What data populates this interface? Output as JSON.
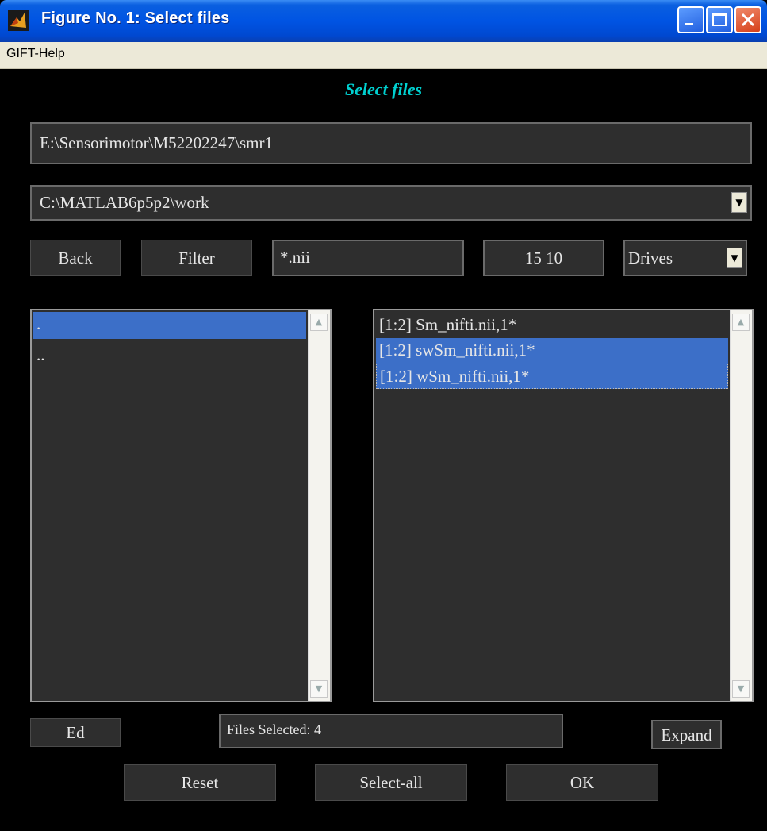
{
  "window": {
    "title": "Figure No. 1: Select files",
    "app_icon": "matlab-icon",
    "controls": [
      "minimize-icon",
      "maximize-icon",
      "close-icon"
    ]
  },
  "menubar": {
    "items": [
      "GIFT-Help"
    ]
  },
  "heading": "Select files",
  "current_dir": "E:\\Sensorimotor\\M52202247\\smr1",
  "history_select": {
    "value": "C:\\MATLAB6p5p2\\work"
  },
  "toolbar": {
    "back_label": "Back",
    "filter_label": "Filter",
    "filter_value": "*.nii",
    "frame_value": "15 10",
    "drives_value": "Drives"
  },
  "dir_list": [
    ".",
    ".."
  ],
  "file_list": [
    {
      "label": "[1:2] Sm_nifti.nii,1*",
      "selected": false
    },
    {
      "label": "[1:2] swSm_nifti.nii,1*",
      "selected": true
    },
    {
      "label": "[1:2] wSm_nifti.nii,1*",
      "selected": true
    }
  ],
  "bottom": {
    "ed_label": "Ed",
    "status": "Files Selected: 4",
    "expand_label": "Expand",
    "reset_label": "Reset",
    "select_all_label": "Select-all",
    "ok_label": "OK"
  }
}
